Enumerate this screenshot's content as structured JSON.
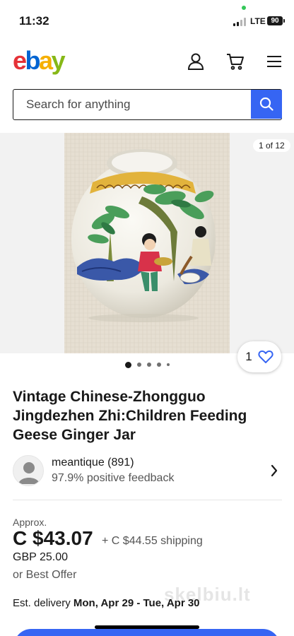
{
  "status": {
    "time": "11:32",
    "network": "LTE",
    "battery": "90"
  },
  "header": {
    "logo": {
      "e": "e",
      "b": "b",
      "a": "a",
      "y": "y"
    }
  },
  "search": {
    "placeholder": "Search for anything"
  },
  "gallery": {
    "counter": "1 of 12",
    "dots_count": 5,
    "active_dot": 0,
    "watch_count": "1"
  },
  "listing": {
    "title": "Vintage Chinese-Zhongguo Jingdezhen Zhi:Children Feeding Geese Ginger Jar"
  },
  "seller": {
    "name": "meantique (891)",
    "feedback": "97.9% positive feedback"
  },
  "price": {
    "approx_label": "Approx.",
    "amount": "C $43.07",
    "shipping": "+ C $44.55 shipping",
    "original": "GBP 25.00",
    "best_offer": "or Best Offer"
  },
  "delivery": {
    "label": "Est. delivery",
    "dates": "Mon, Apr 29 - Tue, Apr 30"
  },
  "watermark": "skelbiu.lt",
  "colors": {
    "accent": "#3665f3",
    "text": "#191919",
    "secondary": "#555555"
  },
  "icons": [
    "user-icon",
    "cart-icon",
    "menu-icon",
    "search-icon",
    "heart-icon",
    "chevron-right-icon"
  ]
}
